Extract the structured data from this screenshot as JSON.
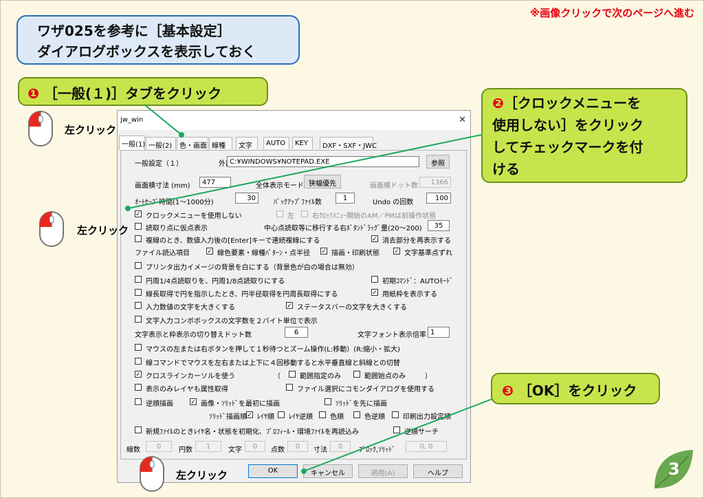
{
  "top_note": "※画像クリックで次のページへ進む",
  "title": {
    "line1": "ワザ025を参考に［基本設定］",
    "line2": "ダイアログボックスを表示しておく"
  },
  "step1": {
    "num": "❶",
    "text": "［一般(１)］タブをクリック"
  },
  "step2": {
    "num": "❷",
    "lines": [
      "［クロックメニューを",
      "使用しない］をクリック",
      "してチェックマークを付",
      "ける"
    ]
  },
  "step3": {
    "num": "❸",
    "text": "［OK］をクリック"
  },
  "click_label": "左クリック",
  "page_number": "3",
  "dialog": {
    "title": "jw_win",
    "close": "✕",
    "tabs": [
      "一般(1)",
      "一般(2)",
      "色・画面",
      "線種",
      "文字",
      "AUTO",
      "KEY",
      "DXF・SXF・JWC"
    ],
    "section_label": "一般設定（１）",
    "editor_label": "外部エディタ",
    "editor_value": "C:¥WINDOWS¥NOTEPAD.EXE",
    "browse_button": "参照",
    "screen_width_label": "画面横寸法 (mm)",
    "screen_width_value": "477",
    "fullscreen_label": "全体表示モード",
    "fullscreen_button": "狭幅優先",
    "screen_dots_label": "画面横ドット数",
    "screen_dots_value": "1366",
    "autosave_label": "ｵｰﾄｾｰﾌﾞ時間(1～1000分)",
    "autosave_value": "30",
    "backup_label": "ﾊﾞｯｸｱｯﾌﾟﾌｧｲﾙ数",
    "backup_value": "1",
    "undo_label": "Undo の回数",
    "undo_value": "100",
    "clock_menu_label": "クロックメニューを使用しない",
    "clock_left_label": "左",
    "clock_ampm_label": "右ｸﾛｯｸﾒﾆｭｰ開始のAM／PMは前操作状態",
    "read_point_label": "読取り点に仮点表示",
    "center_read_label": "中心点読取等に移行する右ﾎﾞﾀﾝﾄﾞﾗｯｸﾞ量(20～200)",
    "center_read_value": "35",
    "multi_line_label": "複線のとき、数値入力後の[Enter]キーで連続複線にする",
    "erase_redraw_label": "消去部分を再表示する",
    "file_read_label": "ファイル読込項目",
    "line_color_label": "線色要素・線種ﾊﾟﾀｰﾝ・点半径",
    "draw_order_label": "描画・印刷状態",
    "text_base_label": "文字基準点ずれ",
    "print_white_label": "プリンタ出力イメージの背景を白にする（背景色が白の場合は無効）",
    "circle_read_label": "円周1/4点読取りを、円周1/8点読取りにする",
    "initial_cmd_label": "初期ｺﾏﾝﾄﾞ：AUTOﾓｰﾄﾞ",
    "length_circle_label": "線長取得で円を指示したとき、円半径取得を円周長取得にする",
    "paper_frame_label": "用紙枠を表示する",
    "input_big_label": "入力数値の文字を大きくする",
    "status_big_label": "ステータスバーの文字を大きくする",
    "combo_byte_label": "文字入力コンボボックスの文字数を２バイト単位で表示",
    "text_switch_label": "文字表示と枠表示の切り替えドット数",
    "text_switch_value": "6",
    "font_scale_label": "文字フォント表示倍率",
    "font_scale_value": "1",
    "zoom_label": "マウスの左または右ボタンを押して１秒待つとズーム操作(L:移動）(R:縮小・拡大)",
    "line_cmd_label": "線コマンドでマウスを左右または上下に４回移動すると水平垂直線と斜線との切替",
    "crossline_label": "クロスラインカーソルを使う",
    "paren_open": "（",
    "range_only_label": "範囲指定のみ",
    "range_start_label": "範囲始点のみ",
    "paren_close": "）",
    "layer_attr_label": "表示のみレイヤも属性取得",
    "common_dialog_label": "ファイル選択にコモンダイアログを使用する",
    "reverse_draw_label": "逆順描画",
    "image_first_label": "画像・ｿﾘｯﾄﾞを最初に描画",
    "solid_first_label": "ｿﾘｯﾄﾞを先に描画",
    "solid_order_label": "ｿﾘｯﾄﾞ描画順",
    "layer_order_label": "ﾚｲﾔ順",
    "layer_reverse_label": "ﾚｲﾔ逆順",
    "color_order_label": "色順",
    "color_reverse_label": "色逆順",
    "print_order_label": "印刷出力設定順",
    "new_file_label": "新規ﾌｧｲﾙのときﾚｲﾔ名・状態を初期化、ﾌﾟﾛﾌｨｰﾙ・環境ﾌｧｲﾙを再読込み",
    "reverse_search_label": "逆順サーチ",
    "stats": [
      {
        "label": "線数",
        "value": "0"
      },
      {
        "label": "円数",
        "value": "1"
      },
      {
        "label": "文字",
        "value": "0"
      },
      {
        "label": "点数",
        "value": "0"
      },
      {
        "label": "寸法",
        "value": "0"
      },
      {
        "label": "ﾌﾞﾛｯｸ,ｿﾘｯﾄﾞ",
        "value": "0, 0"
      }
    ],
    "buttons": {
      "ok": "OK",
      "cancel": "キャンセル",
      "apply": "適用(A)",
      "help": "ヘルプ"
    }
  },
  "colors": {
    "background": "#fdf8e3",
    "accent_red": "#e60012",
    "green_box": "#c8e44c",
    "title_box": "#dde9f7",
    "arrow_line": "#1aa85c"
  }
}
